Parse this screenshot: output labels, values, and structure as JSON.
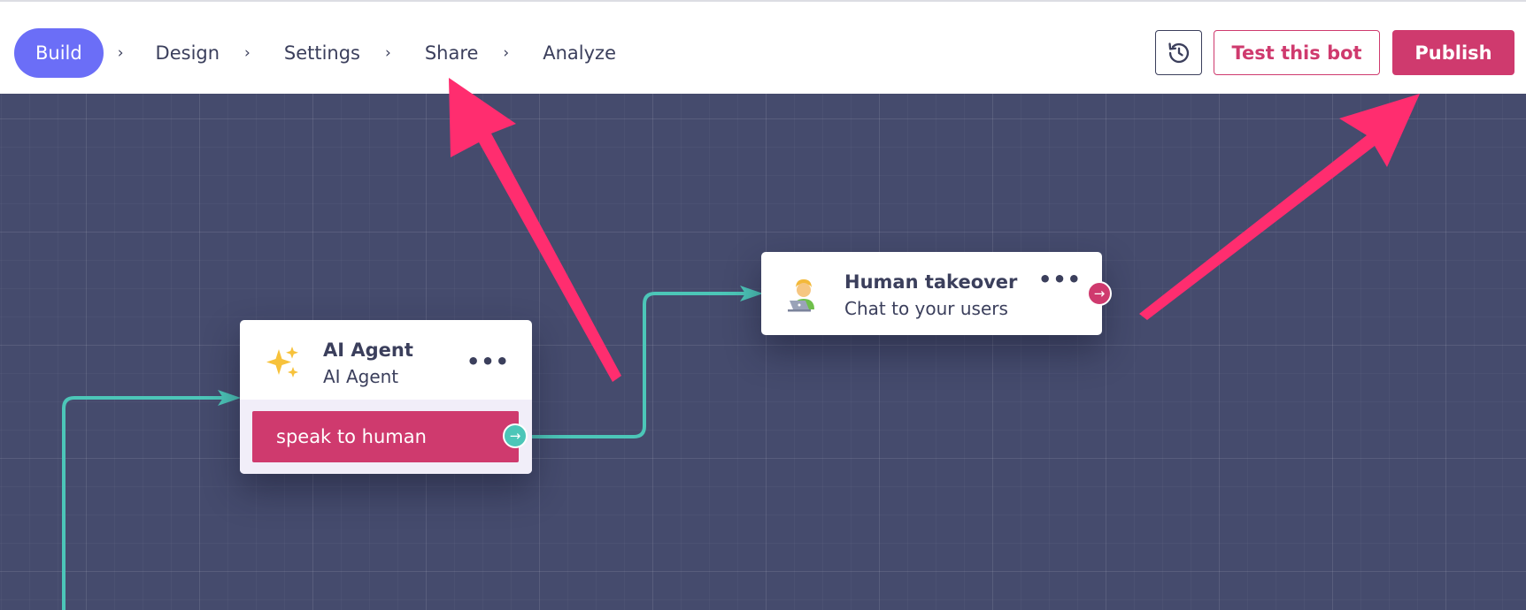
{
  "nav": {
    "build": "Build",
    "items": [
      "Design",
      "Settings",
      "Share",
      "Analyze"
    ],
    "separator": "›"
  },
  "toolbar": {
    "history_icon": "history-icon",
    "test_label": "Test this bot",
    "publish_label": "Publish"
  },
  "nodes": {
    "ai_agent": {
      "icon": "sparkles-icon",
      "title": "AI Agent",
      "subtitle": "AI Agent",
      "menu": "•••",
      "choice": "speak to human",
      "port_glyph": "→"
    },
    "human_takeover": {
      "icon": "technologist-icon",
      "title": "Human takeover",
      "subtitle": "Chat to your users",
      "menu": "•••",
      "port_glyph": "→"
    }
  },
  "colors": {
    "accent": "#cf3a6e",
    "build_pill": "#6b6ef7",
    "canvas": "#454b6d",
    "connector": "#4cc6b8",
    "annotation_arrow": "#ff2d6f"
  }
}
